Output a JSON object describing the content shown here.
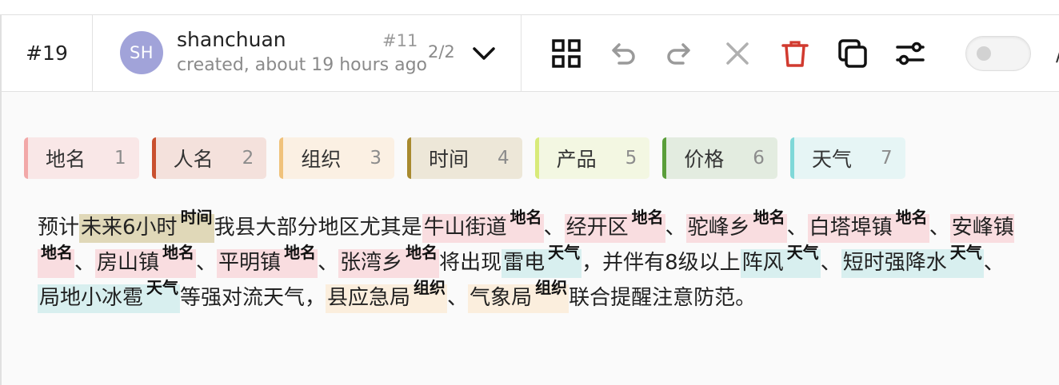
{
  "header": {
    "task_id": "#19",
    "avatar_initials": "SH",
    "username": "shanchuan",
    "created": "created, about 19 hours ago",
    "annotation_id": "#11",
    "annotation_count": "2/2"
  },
  "toolbar": {
    "icons": [
      "grid-icon",
      "undo-icon",
      "redo-icon",
      "close-icon",
      "delete-icon",
      "duplicate-icon",
      "settings-icon"
    ],
    "toggle_on": false,
    "edge_glyph": "/"
  },
  "labels": [
    {
      "name": "地名",
      "hotkey": "1",
      "color": "#f2a8a8",
      "bg": "#f9e7e7"
    },
    {
      "name": "人名",
      "hotkey": "2",
      "color": "#c9502f",
      "bg": "#f4e1dc"
    },
    {
      "name": "组织",
      "hotkey": "3",
      "color": "#f0c27b",
      "bg": "#fbf0e3"
    },
    {
      "name": "时间",
      "hotkey": "4",
      "color": "#a88a2e",
      "bg": "#ede7d8"
    },
    {
      "name": "产品",
      "hotkey": "5",
      "color": "#d8ea7a",
      "bg": "#f3f7e2"
    },
    {
      "name": "价格",
      "hotkey": "6",
      "color": "#5a9e3a",
      "bg": "#e3ece0"
    },
    {
      "name": "天气",
      "hotkey": "7",
      "color": "#7fd8d8",
      "bg": "#e6f5f5"
    }
  ],
  "document": {
    "segments": [
      {
        "text": "预计"
      },
      {
        "text": "未来6小时",
        "label": "时间",
        "bg": "#e0d8b8"
      },
      {
        "text": "我县大部分地区尤其是"
      },
      {
        "text": "牛山街道",
        "label": "地名",
        "bg": "#f9dde0"
      },
      {
        "text": "、"
      },
      {
        "text": "经开区",
        "label": "地名",
        "bg": "#f9dde0"
      },
      {
        "text": "、"
      },
      {
        "text": "驼峰乡",
        "label": "地名",
        "bg": "#f9dde0"
      },
      {
        "text": "、"
      },
      {
        "text": "白塔埠镇",
        "label": "地名",
        "bg": "#f9dde0"
      },
      {
        "text": "、"
      },
      {
        "text": "安峰镇",
        "label": "地名",
        "bg": "#f9dde0"
      },
      {
        "text": "、"
      },
      {
        "text": "房山镇",
        "label": "地名",
        "bg": "#f9dde0"
      },
      {
        "text": "、"
      },
      {
        "text": "平明镇",
        "label": "地名",
        "bg": "#f9dde0"
      },
      {
        "text": "、"
      },
      {
        "text": "张湾乡",
        "label": "地名",
        "bg": "#f9dde0"
      },
      {
        "text": "将出现"
      },
      {
        "text": "雷电",
        "label": "天气",
        "bg": "#d8efef"
      },
      {
        "text": "，并伴有8级以上"
      },
      {
        "text": "阵风",
        "label": "天气",
        "bg": "#d8efef"
      },
      {
        "text": "、"
      },
      {
        "text": "短时强降水",
        "label": "天气",
        "bg": "#d8efef"
      },
      {
        "text": "、"
      },
      {
        "text": "局地小冰雹",
        "label": "天气",
        "bg": "#d8efef"
      },
      {
        "text": "等强对流天气，"
      },
      {
        "text": "县应急局",
        "label": "组织",
        "bg": "#fbeedd"
      },
      {
        "text": "、"
      },
      {
        "text": "气象局",
        "label": "组织",
        "bg": "#fbeedd"
      },
      {
        "text": "联合提醒注意防范。"
      }
    ]
  }
}
